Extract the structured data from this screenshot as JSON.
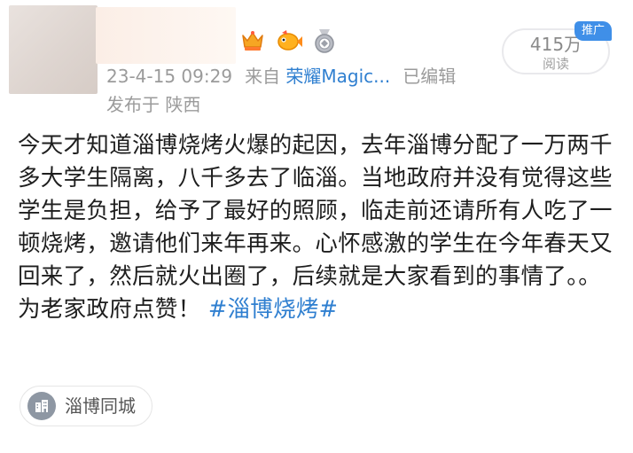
{
  "post": {
    "timestamp": "23-4-15 09:29",
    "source_prefix": "来自",
    "source_app": "荣耀Magic...",
    "edited": "已编辑",
    "location_line": "发布于 陕西",
    "body_text": "今天才知道淄博烧烤火爆的起因，去年淄博分配了一万两千多大学生隔离，八千多去了临淄。当地政府并没有觉得这些学生是负担，给予了最好的照顾，临走前还请所有人吃了一顿烧烤，邀请他们来年再来。心怀感激的学生在今年春天又回来了，然后就火出圈了，后续就是大家看到的事情了。。 为老家政府点赞！",
    "hashtag": "#淄博烧烤#"
  },
  "stats": {
    "read_count": "415万",
    "read_label": "阅读",
    "promo_tag": "推广"
  },
  "badges": [
    "crown-medal-icon",
    "fish-icon",
    "silver-medal-icon"
  ],
  "geo_tag": {
    "icon": "building-icon",
    "label": "淄博同城"
  },
  "colors": {
    "link_blue": "#2f7fd0",
    "meta_gray": "#9b9b9b",
    "promo_blue": "#3f8fe8",
    "body_text": "#1e1e1e"
  }
}
